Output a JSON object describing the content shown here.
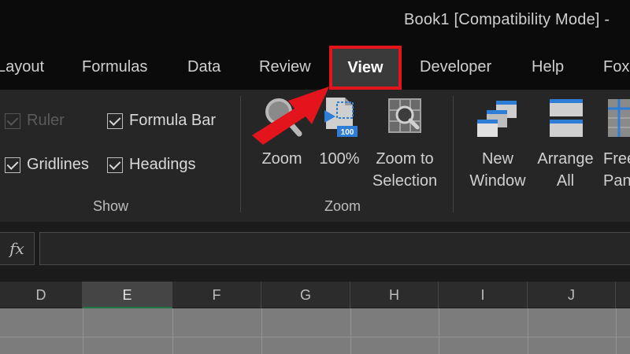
{
  "window": {
    "title": "Book1  [Compatibility Mode]  -"
  },
  "tabs": [
    {
      "label": "Layout"
    },
    {
      "label": "Formulas"
    },
    {
      "label": "Data"
    },
    {
      "label": "Review"
    },
    {
      "label": "View",
      "selected": true
    },
    {
      "label": "Developer"
    },
    {
      "label": "Help"
    },
    {
      "label": "Fox"
    }
  ],
  "ribbon": {
    "show_group": {
      "label": "Show",
      "ruler": {
        "label": "Ruler",
        "checked": true,
        "enabled": false
      },
      "formula_bar": {
        "label": "Formula Bar",
        "checked": true
      },
      "gridlines": {
        "label": "Gridlines",
        "checked": true
      },
      "headings": {
        "label": "Headings",
        "checked": true
      }
    },
    "zoom_group": {
      "label": "Zoom",
      "zoom": {
        "label": "Zoom"
      },
      "hundred": {
        "label": "100%",
        "icon_text": "100"
      },
      "zoom_to_selection": {
        "line1": "Zoom to",
        "line2": "Selection"
      }
    },
    "window_group": {
      "new_window": {
        "line1": "New",
        "line2": "Window"
      },
      "arrange_all": {
        "line1": "Arrange",
        "line2": "All"
      },
      "freeze_panes": {
        "line1": "Free",
        "line2": "Pan"
      }
    }
  },
  "formula_bar": {
    "fx_label": "fx",
    "value": ""
  },
  "columns": [
    "D",
    "E",
    "F",
    "G",
    "H",
    "I",
    "J"
  ],
  "selected_column": "E",
  "colors": {
    "accent_red": "#e3141b",
    "selected_col_border": "#217346"
  }
}
